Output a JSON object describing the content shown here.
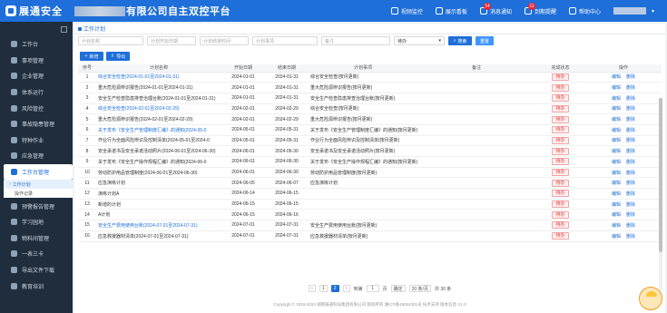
{
  "header": {
    "logo_text": "展通安全",
    "company_suffix": "有限公司自主双控平台",
    "nav": [
      {
        "label": "视频监控",
        "badge": ""
      },
      {
        "label": "展示看板",
        "badge": ""
      },
      {
        "label": "消息通知",
        "badge": "14"
      },
      {
        "label": "到期提醒",
        "badge": "11"
      },
      {
        "label": "帮助中心",
        "badge": ""
      }
    ]
  },
  "sidebar": {
    "items": [
      {
        "label": "工作台"
      },
      {
        "label": "事项管理"
      },
      {
        "label": "企业管理"
      },
      {
        "label": "体系运行"
      },
      {
        "label": "风险管控"
      },
      {
        "label": "事故隐患管理"
      },
      {
        "label": "特种作业"
      },
      {
        "label": "应急管理"
      },
      {
        "label": "工作台管理"
      }
    ],
    "sub_items": [
      {
        "label": "工作计划"
      },
      {
        "label": "操作记录"
      }
    ],
    "items_after": [
      {
        "label": "预警报告管理"
      },
      {
        "label": "学习园地"
      },
      {
        "label": "物料间管理"
      },
      {
        "label": "一表三卡"
      },
      {
        "label": "导出文件下载"
      },
      {
        "label": "教育培训"
      }
    ]
  },
  "main": {
    "tab_label": "工作计划",
    "filters": {
      "plan_name": "计划名称",
      "start_date": "计划开始日期",
      "end_date": "计划结束时间",
      "plan_item": "计划事项",
      "remark": "备注",
      "status": "待办",
      "search_label": "搜索",
      "reset_label": "重置"
    },
    "actions": {
      "add_label": "新增",
      "export_label": "导出"
    },
    "table": {
      "columns": [
        "序号",
        "计划名称",
        "开始日期",
        "结束日期",
        "计划事项",
        "备注",
        "完成状态",
        "操作"
      ],
      "rows": [
        {
          "no": "1",
          "name": "综合安全检查(2024-01-01至2024-01-31)",
          "start": "2024-01-01",
          "end": "2024-01-31",
          "item": "综合安全检查(按月更新)",
          "remark": "",
          "status": "待办",
          "link": true
        },
        {
          "no": "2",
          "name": "重大危险源辨识报告(2024-01-01至2024-01-31)",
          "start": "2024-01-01",
          "end": "2024-01-31",
          "item": "重大危险源辨识报告(按月更新)",
          "remark": "",
          "status": "待办",
          "link": false
        },
        {
          "no": "3",
          "name": "安全生产检查隐患排查治理台账(2024-01-01至2024-01-31)",
          "start": "2024-01-01",
          "end": "2024-01-31",
          "item": "安全生产检查隐患排查治理台账(按月更新)",
          "remark": "",
          "status": "待办",
          "link": false
        },
        {
          "no": "4",
          "name": "综合安全检查(2024-02-01至2024-02-29)",
          "start": "2024-02-01",
          "end": "2024-02-29",
          "item": "综合安全检查(按月更新)",
          "remark": "",
          "status": "待办",
          "link": true
        },
        {
          "no": "5",
          "name": "重大危险源辨识报告(2024-02-01至2024-02-29)",
          "start": "2024-02-01",
          "end": "2024-02-29",
          "item": "重大危险源辨识报告(按月更新)",
          "remark": "",
          "status": "待办",
          "link": false
        },
        {
          "no": "6",
          "name": "关于发布《安全生产管理制度汇编》的通知(2024-05-0",
          "start": "2024-05-01",
          "end": "2024-05-31",
          "item": "关于发布《安全生产管理制度汇编》的通知(按月更新)",
          "remark": "",
          "status": "待办",
          "link": true
        },
        {
          "no": "7",
          "name": "作业行为全面风险辨识及控制清单(2024-05-01至2024-0",
          "start": "2024-05-01",
          "end": "2024-05-31",
          "item": "作业行为全面风险辨识及控制清单(按月更新)",
          "remark": "",
          "status": "待办",
          "link": false
        },
        {
          "no": "8",
          "name": "安全承诺书及安全承诺活动照片(2024-06-01至2024-06-30)",
          "start": "2024-06-01",
          "end": "2024-06-30",
          "item": "安全承诺书及安全承诺活动照片(按月更新)",
          "remark": "",
          "status": "待办",
          "link": false
        },
        {
          "no": "9",
          "name": "关于发布《安全生产操作规程汇编》的通知(2024-06-0",
          "start": "2024-06-01",
          "end": "2024-06-30",
          "item": "关于发布《安全生产操作规程汇编》的通知(按月更新)",
          "remark": "",
          "status": "待办",
          "link": false
        },
        {
          "no": "10",
          "name": "劳动防护用品管理制度(2024-06-01至2024-06-30)",
          "start": "2024-06-01",
          "end": "2024-06-30",
          "item": "劳动防护用品管理制度(按月更新)",
          "remark": "",
          "status": "待办",
          "link": false
        },
        {
          "no": "11",
          "name": "应急演练计划",
          "start": "2024-06-05",
          "end": "2024-06-07",
          "item": "应急演练计划",
          "remark": "",
          "status": "待办",
          "link": false
        },
        {
          "no": "12",
          "name": "演练计划A",
          "start": "2024-06-14",
          "end": "2024-06-15",
          "item": "",
          "remark": "",
          "status": "待办",
          "link": false
        },
        {
          "no": "13",
          "name": "新增的计划",
          "start": "2024-06-15",
          "end": "2024-06-15",
          "item": "",
          "remark": "",
          "status": "待办",
          "link": false
        },
        {
          "no": "14",
          "name": "A计划",
          "start": "2024-06-15",
          "end": "2024-06-16",
          "item": "",
          "remark": "",
          "status": "待办",
          "link": false
        },
        {
          "no": "15",
          "name": "安全生产费用使用台账(2024-07-01至2024-07-31)",
          "start": "2024-07-01",
          "end": "2024-07-31",
          "item": "安全生产费用使用台账(按月更新)",
          "remark": "",
          "status": "待办",
          "link": true
        },
        {
          "no": "16",
          "name": "应急救援器材清单(2024-07-01至2024-07-31)",
          "start": "2024-07-01",
          "end": "2024-07-31",
          "item": "应急救援器材清单(按月更新)",
          "remark": "",
          "status": "待办",
          "link": false
        }
      ],
      "op_edit": "编辑",
      "op_delete": "删除"
    },
    "pagination": {
      "prev": "‹",
      "pages": [
        "1",
        "2"
      ],
      "current": "2",
      "next": "›",
      "goto_label": "到第",
      "goto_value": "1",
      "page_unit": "页",
      "confirm": "确定",
      "page_size": "20 条/页",
      "total": "共 30 条"
    },
    "footer": "Copyright © 2019-2024 湖南展通科技集团有限公司 版权所有 湘ICP备19004301号 技术支持 版本信息 V1.0"
  }
}
